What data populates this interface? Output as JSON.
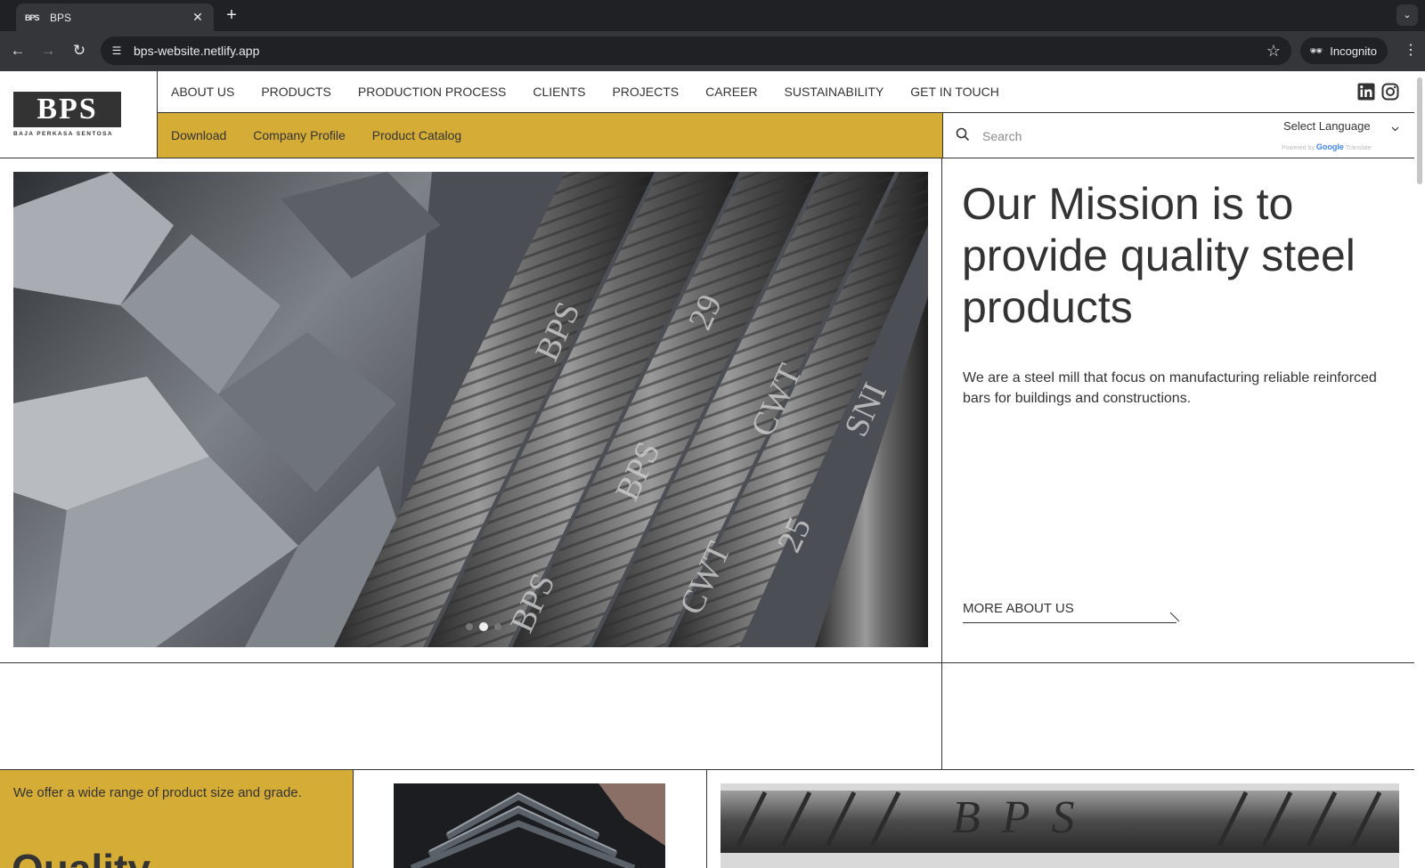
{
  "browser": {
    "tab_title": "BPS",
    "tab_favicon": "BPS",
    "url": "bps-website.netlify.app",
    "incognito_label": "Incognito"
  },
  "logo": {
    "mark": "BPS",
    "subtitle": "BAJA PERKASA SENTOSA"
  },
  "nav": {
    "main": [
      "ABOUT US",
      "PRODUCTS",
      "PRODUCTION PROCESS",
      "CLIENTS",
      "PROJECTS",
      "CAREER",
      "SUSTAINABILITY",
      "GET IN TOUCH"
    ],
    "sub": [
      "Download",
      "Company Profile",
      "Product Catalog"
    ]
  },
  "search": {
    "placeholder": "Search"
  },
  "language": {
    "selected": "Select Language",
    "powered_by": "Powered by",
    "google": "Google",
    "translate": "Translate"
  },
  "hero": {
    "slide_count": 3,
    "active_slide": 2,
    "heading": "Our Mission is to provide quality steel products",
    "description": "We are a steel mill that focus on manufacturing reliable reinforced bars for buildings and constructions.",
    "more_link": "MORE ABOUT US",
    "rebar_marks": [
      "BPS",
      "BPS",
      "BPS",
      "29",
      "25",
      "CWT",
      "CWT",
      "SNI"
    ]
  },
  "products": {
    "tagline": "We offer a wide range of product size and grade.",
    "title": "Quality",
    "rebar_mark": "BPS"
  },
  "colors": {
    "accent": "#d4ac36",
    "text": "#333333",
    "chrome_dark": "#202124",
    "chrome": "#35363a"
  }
}
